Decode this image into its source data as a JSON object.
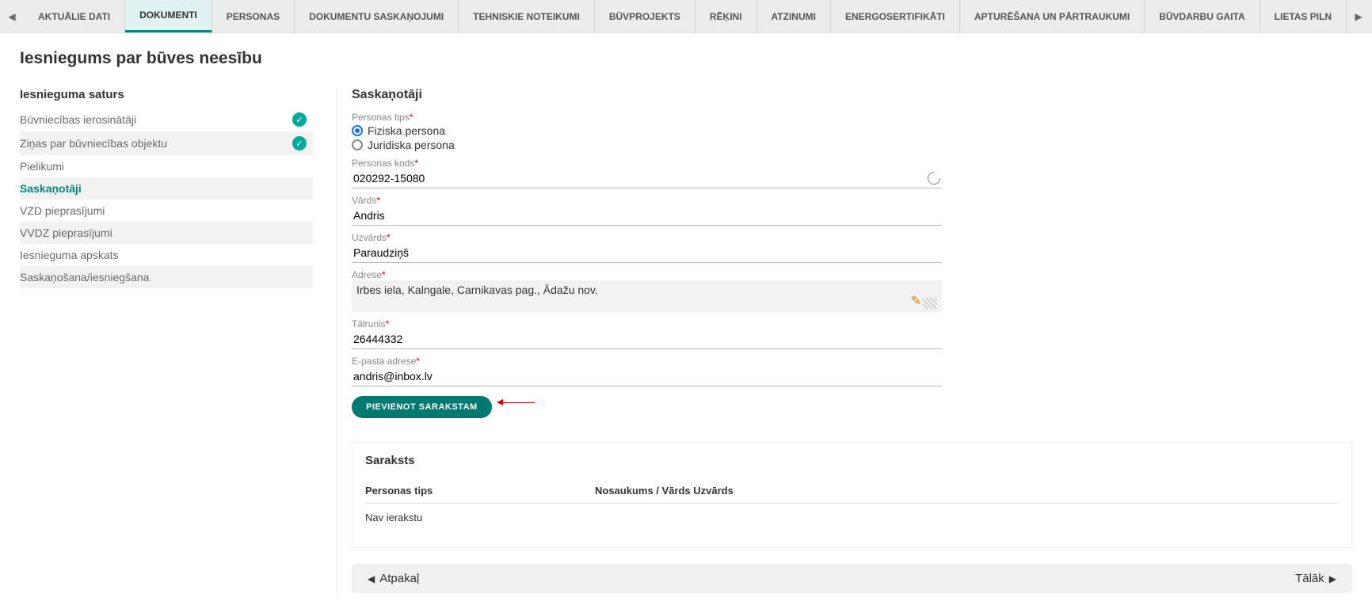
{
  "tabs": [
    "AKTUĀLIE DATI",
    "DOKUMENTI",
    "PERSONAS",
    "DOKUMENTU SASKAŅOJUMI",
    "TEHNISKIE NOTEIKUMI",
    "BŪVPROJEKTS",
    "RĒĶINI",
    "ATZINUMI",
    "ENERGOSERTIFIKĀTI",
    "APTURĒŠANA UN PĀRTRAUKUMI",
    "BŪVDARBU GAITA",
    "LIETAS PILN"
  ],
  "active_tab_index": 1,
  "page_title": "Iesniegums par būves neesību",
  "side_title": "Iesnieguma saturs",
  "side_items": [
    {
      "label": "Būvniecības ierosinātāji",
      "checked": true
    },
    {
      "label": "Ziņas par būvniecības objektu",
      "checked": true
    },
    {
      "label": "Pielikumi",
      "checked": false
    },
    {
      "label": "Saskaņotāji",
      "checked": false,
      "active": true
    },
    {
      "label": "VZD pieprasījumi",
      "checked": false
    },
    {
      "label": "VVDZ pieprasījumi",
      "checked": false
    },
    {
      "label": "Iesnieguma apskats",
      "checked": false
    },
    {
      "label": "Saskaņošana/iesniegšana",
      "checked": false
    }
  ],
  "form": {
    "section_title": "Saskaņotāji",
    "persona_tips_label": "Personas tips",
    "radio_fiziska": "Fiziska persona",
    "radio_juridiska": "Juridiska persona",
    "personas_kods_label": "Personas kods",
    "personas_kods_value": "020292-15080",
    "vards_label": "Vārds",
    "vards_value": "Andris",
    "uzvards_label": "Uzvārds",
    "uzvards_value": "Paraudziņš",
    "adrese_label": "Adrese",
    "adrese_value": "Irbes iela, Kalngale, Carnikavas pag., Ādažu nov.",
    "talrunis_label": "Tālrunis",
    "talrunis_value": "26444332",
    "epasts_label": "E-pasta adrese",
    "epasts_value": "andris@inbox.lv",
    "add_button": "PIEVIENOT SARAKSTAM"
  },
  "list": {
    "title": "Saraksts",
    "col1": "Personas tips",
    "col2": "Nosaukums / Vārds Uzvārds",
    "empty": "Nav ierakstu"
  },
  "pager": {
    "back": "Atpakaļ",
    "next": "Tālāk"
  }
}
